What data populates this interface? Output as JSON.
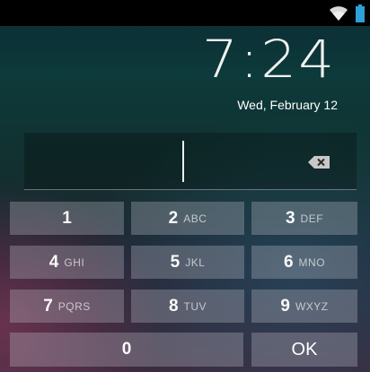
{
  "status_bar": {
    "wifi_icon": "wifi-icon",
    "battery_icon": "battery-icon"
  },
  "lock": {
    "time": "7:24",
    "date": "Wed, February 12"
  },
  "pin_entry": {
    "value": "",
    "backspace_icon": "backspace-icon"
  },
  "keypad": {
    "keys": [
      {
        "digit": "1",
        "letters": ""
      },
      {
        "digit": "2",
        "letters": "ABC"
      },
      {
        "digit": "3",
        "letters": "DEF"
      },
      {
        "digit": "4",
        "letters": "GHI"
      },
      {
        "digit": "5",
        "letters": "JKL"
      },
      {
        "digit": "6",
        "letters": "MNO"
      },
      {
        "digit": "7",
        "letters": "PQRS"
      },
      {
        "digit": "8",
        "letters": "TUV"
      },
      {
        "digit": "9",
        "letters": "WXYZ"
      }
    ],
    "zero": "0",
    "ok": "OK"
  }
}
